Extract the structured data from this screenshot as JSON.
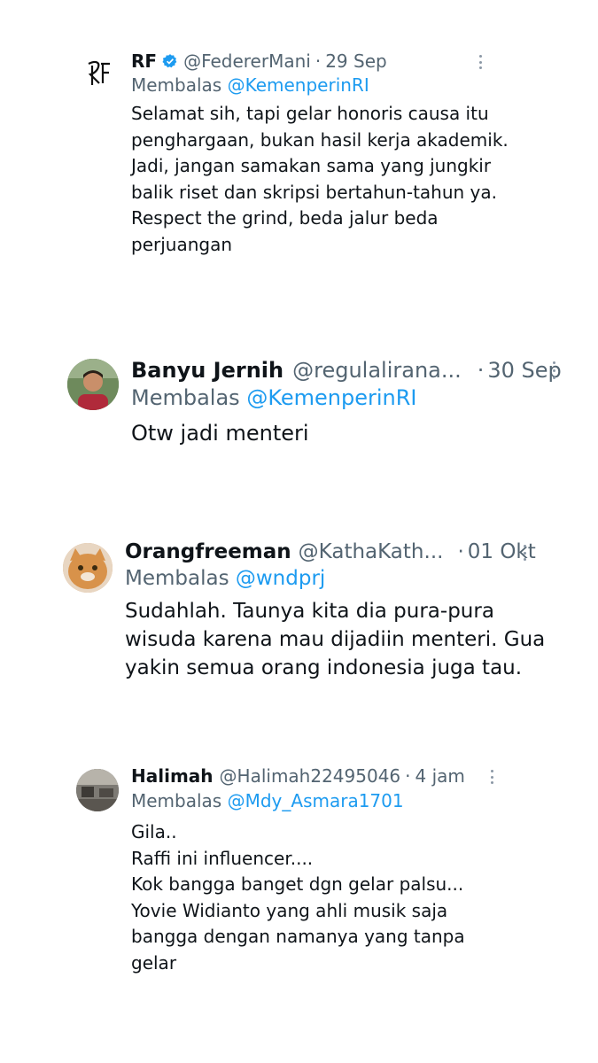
{
  "replying_to_label": "Membalas",
  "tweets": [
    {
      "name": "RF",
      "verified": true,
      "handle": "@FedererMani",
      "separator": "·",
      "time": "29 Sep",
      "reply_to": "@KemenperinRI",
      "lines": [
        "Selamat sih, tapi gelar honoris causa itu",
        "penghargaan, bukan hasil kerja akademik.",
        "Jadi, jangan samakan sama yang jungkir",
        "balik riset dan skripsi bertahun-tahun ya.",
        "Respect the grind, beda jalur beda",
        "perjuangan"
      ],
      "avatar_icon": "rf-logo-icon"
    },
    {
      "name": "Banyu Jernih",
      "verified": false,
      "handle": "@regulalirana...",
      "separator": "·",
      "time": "30 Sep",
      "reply_to": "@KemenperinRI",
      "lines": [
        "Otw jadi menteri"
      ],
      "avatar_icon": "person-photo-icon"
    },
    {
      "name": "Orangfreeman",
      "verified": false,
      "handle": "@KathaKath...",
      "separator": "·",
      "time": "01 Okt",
      "reply_to": "@wndprj",
      "lines": [
        "Sudahlah. Taunya kita dia pura-pura",
        "wisuda karena mau dijadiin menteri. Gua",
        "yakin semua orang indonesia juga tau."
      ],
      "avatar_icon": "cat-photo-icon"
    },
    {
      "name": "Halimah",
      "verified": false,
      "handle": "@Halimah22495046",
      "separator": "·",
      "time": "4 jam",
      "reply_to": "@Mdy_Asmara1701",
      "lines": [
        "Gila..",
        "Raffi ini influencer....",
        "Kok bangga banget dgn gelar palsu...",
        "Yovie Widianto yang ahli musik saja",
        "bangga dengan namanya yang tanpa",
        "gelar"
      ],
      "avatar_icon": "room-photo-icon"
    }
  ],
  "colors": {
    "text": "#0f1419",
    "muted": "#536471",
    "link": "#1d9bf0",
    "verified": "#1d9bf0"
  }
}
